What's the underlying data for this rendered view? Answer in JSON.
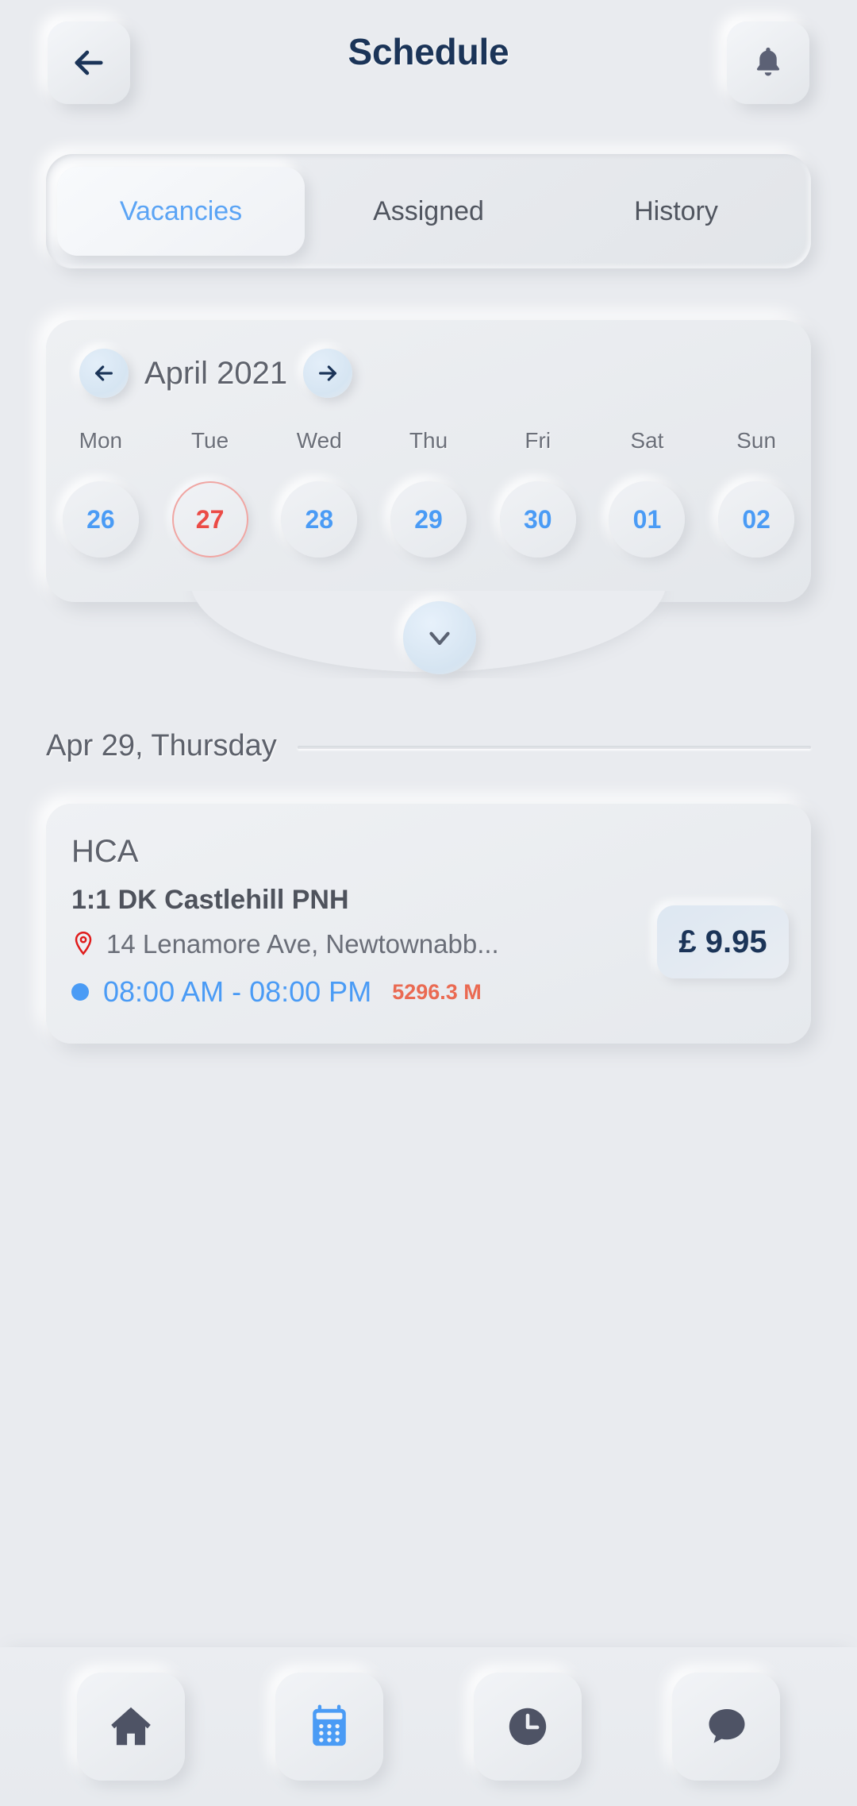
{
  "header": {
    "title": "Schedule",
    "back_icon": "arrow-left-icon",
    "notification_icon": "bell-icon"
  },
  "tabs": [
    {
      "label": "Vacancies",
      "active": true
    },
    {
      "label": "Assigned",
      "active": false
    },
    {
      "label": "History",
      "active": false
    }
  ],
  "calendar": {
    "month_label": "April 2021",
    "prev_icon": "arrow-left-icon",
    "next_icon": "arrow-right-icon",
    "expand_icon": "chevron-down-icon",
    "weekdays": [
      "Mon",
      "Tue",
      "Wed",
      "Thu",
      "Fri",
      "Sat",
      "Sun"
    ],
    "dates": [
      {
        "day": "26",
        "state": "normal"
      },
      {
        "day": "27",
        "state": "today"
      },
      {
        "day": "28",
        "state": "normal"
      },
      {
        "day": "29",
        "state": "normal"
      },
      {
        "day": "30",
        "state": "normal"
      },
      {
        "day": "01",
        "state": "normal"
      },
      {
        "day": "02",
        "state": "normal"
      }
    ]
  },
  "day_section": {
    "label": "Apr 29, Thursday"
  },
  "job": {
    "role": "HCA",
    "title": "1:1 DK Castlehill PNH",
    "address": "14 Lenamore Ave, Newtownabb...",
    "address_icon": "location-pin-icon",
    "time": "08:00 AM - 08:00 PM",
    "time_dot_icon": "blue-dot-icon",
    "distance": "5296.3 M",
    "price": "£ 9.95"
  },
  "bottom_nav": [
    {
      "icon": "home-icon",
      "active": false
    },
    {
      "icon": "calendar-icon",
      "active": true
    },
    {
      "icon": "clock-icon",
      "active": false
    },
    {
      "icon": "chat-icon",
      "active": false
    }
  ],
  "colors": {
    "background": "#e9ebef",
    "accent_blue": "#4a9bf5",
    "title_navy": "#1b3458",
    "today_red": "#eb4b46",
    "distance_orange": "#ea6a52",
    "pin_red": "#e01b1b",
    "text_gray": "#5d616b"
  }
}
